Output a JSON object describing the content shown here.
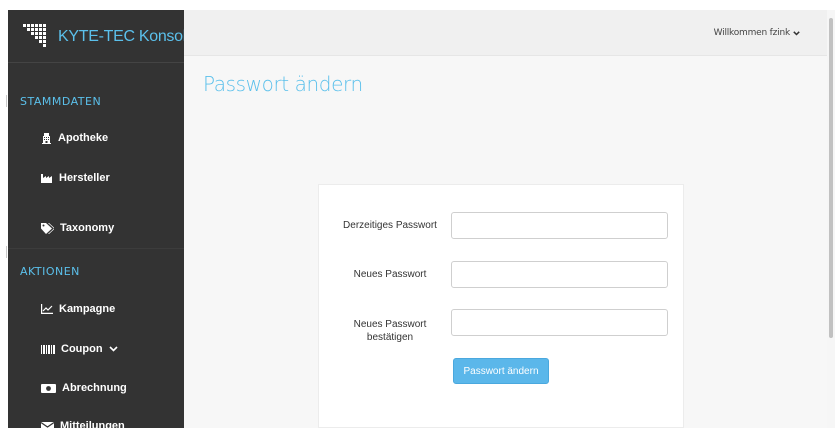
{
  "brand": {
    "name": "KYTE-TEC Konsole"
  },
  "header": {
    "welcome": "Willkommen fzink"
  },
  "sidebar": {
    "sections": [
      {
        "title": "STAMMDATEN",
        "items": [
          {
            "label": "Apotheke",
            "icon": "building-icon"
          },
          {
            "label": "Hersteller",
            "icon": "factory-icon"
          },
          {
            "label": "Taxonomy",
            "icon": "tags-icon"
          }
        ]
      },
      {
        "title": "AKTIONEN",
        "items": [
          {
            "label": "Kampagne",
            "icon": "line-chart-icon"
          },
          {
            "label": "Coupon",
            "icon": "barcode-icon"
          },
          {
            "label": "Abrechnung",
            "icon": "money-icon"
          },
          {
            "label": "Mitteilungen",
            "icon": "envelope-icon"
          }
        ]
      }
    ]
  },
  "page": {
    "title": "Passwort ändern"
  },
  "form": {
    "current_label": "Derzeitiges Passwort",
    "current_value": "",
    "new_label": "Neues Passwort",
    "new_value": "",
    "confirm_label_line1": "Neues Passwort",
    "confirm_label_line2": "bestätigen",
    "confirm_value": "",
    "submit_label": "Passwort ändern"
  },
  "colors": {
    "accent": "#5bc0eb",
    "sidebar_bg": "#333333",
    "button": "#5bb7ea"
  }
}
